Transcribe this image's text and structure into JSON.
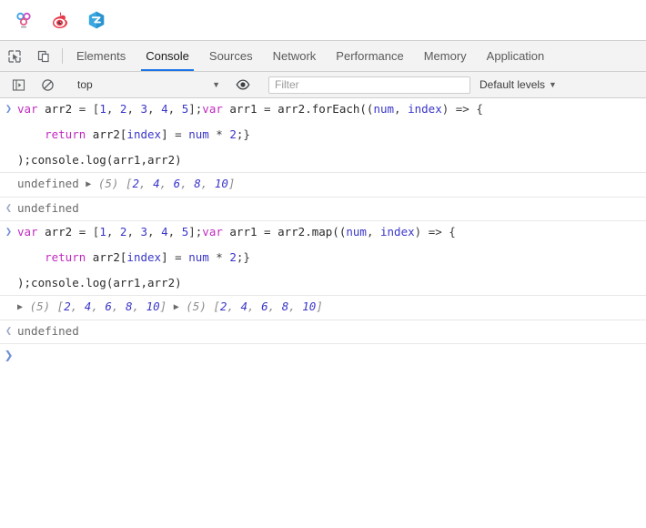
{
  "browser": {
    "extensions": [
      {
        "name": "molecule-extension-icon",
        "title": "extension"
      },
      {
        "name": "weibo-icon",
        "title": "Weibo"
      },
      {
        "name": "zhihu-icon",
        "title": "Z app"
      }
    ]
  },
  "devtools": {
    "tools": [
      {
        "name": "inspect-element-icon",
        "label": "Inspect element"
      },
      {
        "name": "device-toolbar-icon",
        "label": "Toggle device toolbar"
      }
    ],
    "tabs": [
      {
        "label": "Elements",
        "active": false
      },
      {
        "label": "Console",
        "active": true
      },
      {
        "label": "Sources",
        "active": false
      },
      {
        "label": "Network",
        "active": false
      },
      {
        "label": "Performance",
        "active": false
      },
      {
        "label": "Memory",
        "active": false
      },
      {
        "label": "Application",
        "active": false
      }
    ]
  },
  "console_toolbar": {
    "sidebar_toggle_icon": "show-console-sidebar-icon",
    "clear_icon": "clear-console-icon",
    "context": "top",
    "context_caret": "▼",
    "eye_icon": "create-live-expression-icon",
    "filter_placeholder": "Filter",
    "levels_label": "Default levels",
    "levels_caret": "▼"
  },
  "console": {
    "prompt_marker": "❯",
    "return_marker": "❮",
    "messages": [
      {
        "type": "input",
        "lines": [
          [
            {
              "t": "kw",
              "v": "var"
            },
            {
              "t": "plain",
              "v": " arr2 "
            },
            {
              "t": "punct",
              "v": "="
            },
            {
              "t": "plain",
              "v": " "
            },
            {
              "t": "punct",
              "v": "["
            },
            {
              "t": "num",
              "v": "1"
            },
            {
              "t": "punct",
              "v": ", "
            },
            {
              "t": "num",
              "v": "2"
            },
            {
              "t": "punct",
              "v": ", "
            },
            {
              "t": "num",
              "v": "3"
            },
            {
              "t": "punct",
              "v": ", "
            },
            {
              "t": "num",
              "v": "4"
            },
            {
              "t": "punct",
              "v": ", "
            },
            {
              "t": "num",
              "v": "5"
            },
            {
              "t": "punct",
              "v": "];"
            },
            {
              "t": "kw",
              "v": "var"
            },
            {
              "t": "plain",
              "v": " arr1 "
            },
            {
              "t": "punct",
              "v": "="
            },
            {
              "t": "plain",
              "v": " arr2.forEach(("
            },
            {
              "t": "param",
              "v": "num"
            },
            {
              "t": "punct",
              "v": ", "
            },
            {
              "t": "param",
              "v": "index"
            },
            {
              "t": "punct",
              "v": ") => {"
            }
          ],
          [
            {
              "t": "gap",
              "v": ""
            }
          ],
          [
            {
              "t": "plain",
              "v": "    "
            },
            {
              "t": "kw",
              "v": "return"
            },
            {
              "t": "plain",
              "v": " arr2["
            },
            {
              "t": "param",
              "v": "index"
            },
            {
              "t": "plain",
              "v": "] "
            },
            {
              "t": "punct",
              "v": "="
            },
            {
              "t": "plain",
              "v": " "
            },
            {
              "t": "param",
              "v": "num"
            },
            {
              "t": "plain",
              "v": " "
            },
            {
              "t": "punct",
              "v": "*"
            },
            {
              "t": "plain",
              "v": " "
            },
            {
              "t": "num",
              "v": "2"
            },
            {
              "t": "punct",
              "v": ";}"
            }
          ],
          [
            {
              "t": "gap",
              "v": ""
            }
          ],
          [
            {
              "t": "plain",
              "v": ");console.log(arr1,arr2)"
            }
          ]
        ]
      },
      {
        "type": "log",
        "undefined_label": "undefined",
        "arrays": [
          {
            "disclosure": "▶",
            "count": "(5)",
            "open": "[",
            "values": [
              "2",
              "4",
              "6",
              "8",
              "10"
            ],
            "close": "]"
          }
        ]
      },
      {
        "type": "result",
        "value": "undefined"
      },
      {
        "type": "input",
        "lines": [
          [
            {
              "t": "kw",
              "v": "var"
            },
            {
              "t": "plain",
              "v": " arr2 "
            },
            {
              "t": "punct",
              "v": "="
            },
            {
              "t": "plain",
              "v": " "
            },
            {
              "t": "punct",
              "v": "["
            },
            {
              "t": "num",
              "v": "1"
            },
            {
              "t": "punct",
              "v": ", "
            },
            {
              "t": "num",
              "v": "2"
            },
            {
              "t": "punct",
              "v": ", "
            },
            {
              "t": "num",
              "v": "3"
            },
            {
              "t": "punct",
              "v": ", "
            },
            {
              "t": "num",
              "v": "4"
            },
            {
              "t": "punct",
              "v": ", "
            },
            {
              "t": "num",
              "v": "5"
            },
            {
              "t": "punct",
              "v": "];"
            },
            {
              "t": "kw",
              "v": "var"
            },
            {
              "t": "plain",
              "v": " arr1 "
            },
            {
              "t": "punct",
              "v": "="
            },
            {
              "t": "plain",
              "v": " arr2.map(("
            },
            {
              "t": "param",
              "v": "num"
            },
            {
              "t": "punct",
              "v": ", "
            },
            {
              "t": "param",
              "v": "index"
            },
            {
              "t": "punct",
              "v": ") => {"
            }
          ],
          [
            {
              "t": "gap",
              "v": ""
            }
          ],
          [
            {
              "t": "plain",
              "v": "    "
            },
            {
              "t": "kw",
              "v": "return"
            },
            {
              "t": "plain",
              "v": " arr2["
            },
            {
              "t": "param",
              "v": "index"
            },
            {
              "t": "plain",
              "v": "] "
            },
            {
              "t": "punct",
              "v": "="
            },
            {
              "t": "plain",
              "v": " "
            },
            {
              "t": "param",
              "v": "num"
            },
            {
              "t": "plain",
              "v": " "
            },
            {
              "t": "punct",
              "v": "*"
            },
            {
              "t": "plain",
              "v": " "
            },
            {
              "t": "num",
              "v": "2"
            },
            {
              "t": "punct",
              "v": ";}"
            }
          ],
          [
            {
              "t": "gap",
              "v": ""
            }
          ],
          [
            {
              "t": "plain",
              "v": ");console.log(arr1,arr2)"
            }
          ]
        ]
      },
      {
        "type": "log",
        "undefined_label": "",
        "arrays": [
          {
            "disclosure": "▶",
            "count": "(5)",
            "open": "[",
            "values": [
              "2",
              "4",
              "6",
              "8",
              "10"
            ],
            "close": "]"
          },
          {
            "disclosure": "▶",
            "count": "(5)",
            "open": "[",
            "values": [
              "2",
              "4",
              "6",
              "8",
              "10"
            ],
            "close": "]"
          }
        ]
      },
      {
        "type": "result",
        "value": "undefined"
      }
    ]
  }
}
